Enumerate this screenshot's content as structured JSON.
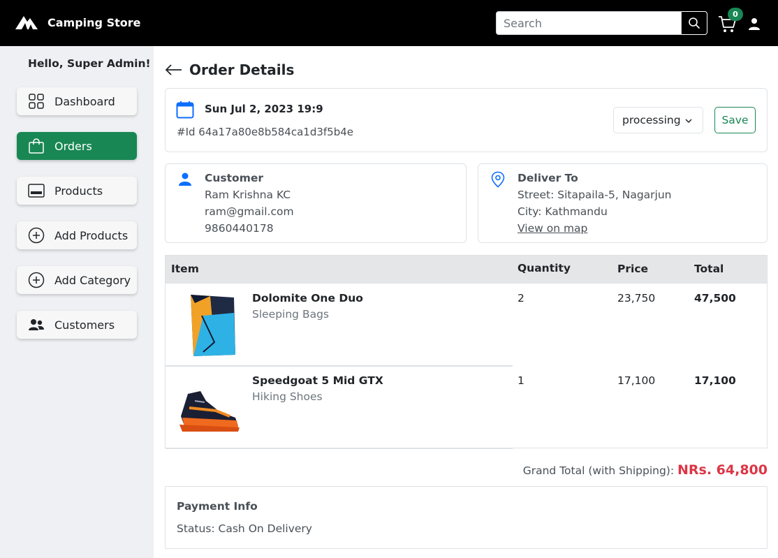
{
  "header": {
    "brand_name": "Camping Store",
    "search_placeholder": "Search",
    "cart_count": "0"
  },
  "sidebar": {
    "greeting": "Hello, Super Admin!",
    "items": [
      {
        "label": "Dashboard",
        "icon": "grid-icon",
        "active": false
      },
      {
        "label": "Orders",
        "icon": "bag-icon",
        "active": true
      },
      {
        "label": "Products",
        "icon": "card-icon",
        "active": false
      },
      {
        "label": "Add Products",
        "icon": "plus-circle-icon",
        "active": false
      },
      {
        "label": "Add Category",
        "icon": "plus-circle-icon",
        "active": false
      },
      {
        "label": "Customers",
        "icon": "people-icon",
        "active": false
      }
    ]
  },
  "order": {
    "title": "Order Details",
    "date": "Sun Jul 2, 2023 19:9",
    "id": "#Id 64a17a80e8b584ca1d3f5b4e",
    "status": "processing",
    "save_label": "Save"
  },
  "customer": {
    "title": "Customer",
    "name": "Ram Krishna KC",
    "email": "ram@gmail.com",
    "phone": "9860440178"
  },
  "delivery": {
    "title": "Deliver To",
    "street": "Street: Sitapaila-5, Nagarjun",
    "city": "City: Kathmandu",
    "map_link": "View on map"
  },
  "table": {
    "headers": {
      "item": "Item",
      "quantity": "Quantity",
      "price": "Price",
      "total": "Total"
    },
    "rows": [
      {
        "name": "Dolomite One Duo",
        "category": "Sleeping Bags",
        "quantity": "2",
        "price": "23,750",
        "total": "47,500"
      },
      {
        "name": "Speedgoat 5 Mid GTX",
        "category": "Hiking Shoes",
        "quantity": "1",
        "price": "17,100",
        "total": "17,100"
      }
    ]
  },
  "summary": {
    "grand_label": "Grand Total (with Shipping):",
    "grand_value": "NRs. 64,800"
  },
  "payment": {
    "title": "Payment Info",
    "status": "Status: Cash On Delivery"
  },
  "colors": {
    "brand_green": "#198754",
    "accent_blue": "#0d6efd",
    "total_red": "#dc3545"
  }
}
